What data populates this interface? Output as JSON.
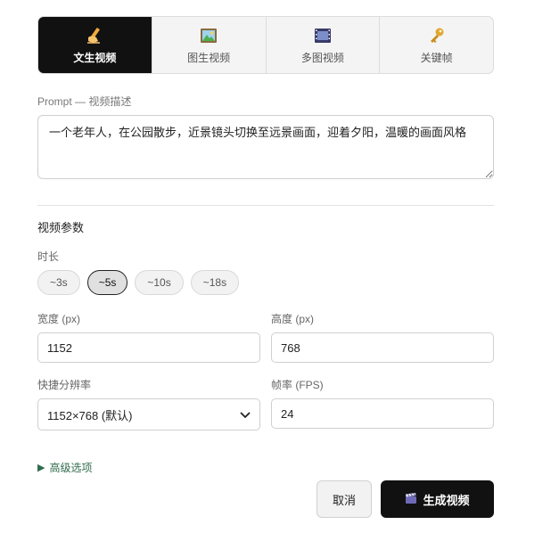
{
  "tabs": [
    {
      "label": "文生视频",
      "icon": "writing-hand-icon",
      "active": true
    },
    {
      "label": "图生视频",
      "icon": "picture-icon",
      "active": false
    },
    {
      "label": "多图视频",
      "icon": "film-frames-icon",
      "active": false
    },
    {
      "label": "关键帧",
      "icon": "key-icon",
      "active": false
    }
  ],
  "prompt": {
    "label": "Prompt — 视频描述",
    "value": "一个老年人，在公园散步，近景镜头切换至远景画面，迎着夕阳，温暖的画面风格"
  },
  "params": {
    "section_title": "视频参数",
    "duration_label": "时长",
    "durations": [
      "~3s",
      "~5s",
      "~10s",
      "~18s"
    ],
    "selected_duration": "~5s",
    "width_label": "宽度 (px)",
    "width_value": "1152",
    "height_label": "高度 (px)",
    "height_value": "768",
    "resolution_label": "快捷分辨率",
    "resolution_value": "1152×768 (默认)",
    "fps_label": "帧率 (FPS)",
    "fps_value": "24"
  },
  "advanced": {
    "label": "高级选项"
  },
  "actions": {
    "cancel_label": "取消",
    "generate_label": "生成视频",
    "generate_icon": "clapper-icon"
  },
  "colors": {
    "active_tab_bg": "#111111",
    "primary_button_bg": "#111111",
    "advanced_link": "#2f6b4a"
  }
}
